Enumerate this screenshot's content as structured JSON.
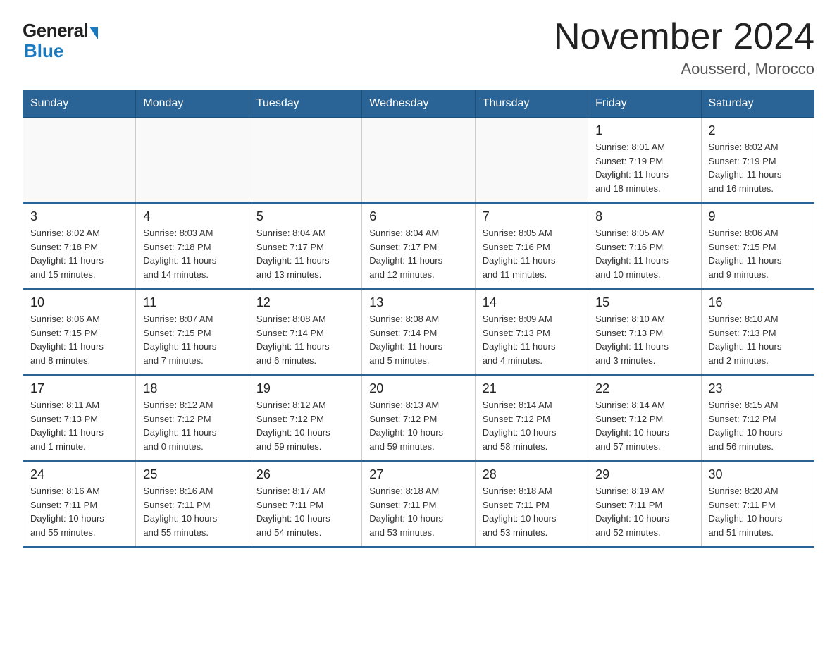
{
  "logo": {
    "general": "General",
    "blue": "Blue"
  },
  "title": "November 2024",
  "location": "Aousserd, Morocco",
  "days_of_week": [
    "Sunday",
    "Monday",
    "Tuesday",
    "Wednesday",
    "Thursday",
    "Friday",
    "Saturday"
  ],
  "weeks": [
    [
      {
        "day": "",
        "info": ""
      },
      {
        "day": "",
        "info": ""
      },
      {
        "day": "",
        "info": ""
      },
      {
        "day": "",
        "info": ""
      },
      {
        "day": "",
        "info": ""
      },
      {
        "day": "1",
        "info": "Sunrise: 8:01 AM\nSunset: 7:19 PM\nDaylight: 11 hours\nand 18 minutes."
      },
      {
        "day": "2",
        "info": "Sunrise: 8:02 AM\nSunset: 7:19 PM\nDaylight: 11 hours\nand 16 minutes."
      }
    ],
    [
      {
        "day": "3",
        "info": "Sunrise: 8:02 AM\nSunset: 7:18 PM\nDaylight: 11 hours\nand 15 minutes."
      },
      {
        "day": "4",
        "info": "Sunrise: 8:03 AM\nSunset: 7:18 PM\nDaylight: 11 hours\nand 14 minutes."
      },
      {
        "day": "5",
        "info": "Sunrise: 8:04 AM\nSunset: 7:17 PM\nDaylight: 11 hours\nand 13 minutes."
      },
      {
        "day": "6",
        "info": "Sunrise: 8:04 AM\nSunset: 7:17 PM\nDaylight: 11 hours\nand 12 minutes."
      },
      {
        "day": "7",
        "info": "Sunrise: 8:05 AM\nSunset: 7:16 PM\nDaylight: 11 hours\nand 11 minutes."
      },
      {
        "day": "8",
        "info": "Sunrise: 8:05 AM\nSunset: 7:16 PM\nDaylight: 11 hours\nand 10 minutes."
      },
      {
        "day": "9",
        "info": "Sunrise: 8:06 AM\nSunset: 7:15 PM\nDaylight: 11 hours\nand 9 minutes."
      }
    ],
    [
      {
        "day": "10",
        "info": "Sunrise: 8:06 AM\nSunset: 7:15 PM\nDaylight: 11 hours\nand 8 minutes."
      },
      {
        "day": "11",
        "info": "Sunrise: 8:07 AM\nSunset: 7:15 PM\nDaylight: 11 hours\nand 7 minutes."
      },
      {
        "day": "12",
        "info": "Sunrise: 8:08 AM\nSunset: 7:14 PM\nDaylight: 11 hours\nand 6 minutes."
      },
      {
        "day": "13",
        "info": "Sunrise: 8:08 AM\nSunset: 7:14 PM\nDaylight: 11 hours\nand 5 minutes."
      },
      {
        "day": "14",
        "info": "Sunrise: 8:09 AM\nSunset: 7:13 PM\nDaylight: 11 hours\nand 4 minutes."
      },
      {
        "day": "15",
        "info": "Sunrise: 8:10 AM\nSunset: 7:13 PM\nDaylight: 11 hours\nand 3 minutes."
      },
      {
        "day": "16",
        "info": "Sunrise: 8:10 AM\nSunset: 7:13 PM\nDaylight: 11 hours\nand 2 minutes."
      }
    ],
    [
      {
        "day": "17",
        "info": "Sunrise: 8:11 AM\nSunset: 7:13 PM\nDaylight: 11 hours\nand 1 minute."
      },
      {
        "day": "18",
        "info": "Sunrise: 8:12 AM\nSunset: 7:12 PM\nDaylight: 11 hours\nand 0 minutes."
      },
      {
        "day": "19",
        "info": "Sunrise: 8:12 AM\nSunset: 7:12 PM\nDaylight: 10 hours\nand 59 minutes."
      },
      {
        "day": "20",
        "info": "Sunrise: 8:13 AM\nSunset: 7:12 PM\nDaylight: 10 hours\nand 59 minutes."
      },
      {
        "day": "21",
        "info": "Sunrise: 8:14 AM\nSunset: 7:12 PM\nDaylight: 10 hours\nand 58 minutes."
      },
      {
        "day": "22",
        "info": "Sunrise: 8:14 AM\nSunset: 7:12 PM\nDaylight: 10 hours\nand 57 minutes."
      },
      {
        "day": "23",
        "info": "Sunrise: 8:15 AM\nSunset: 7:12 PM\nDaylight: 10 hours\nand 56 minutes."
      }
    ],
    [
      {
        "day": "24",
        "info": "Sunrise: 8:16 AM\nSunset: 7:11 PM\nDaylight: 10 hours\nand 55 minutes."
      },
      {
        "day": "25",
        "info": "Sunrise: 8:16 AM\nSunset: 7:11 PM\nDaylight: 10 hours\nand 55 minutes."
      },
      {
        "day": "26",
        "info": "Sunrise: 8:17 AM\nSunset: 7:11 PM\nDaylight: 10 hours\nand 54 minutes."
      },
      {
        "day": "27",
        "info": "Sunrise: 8:18 AM\nSunset: 7:11 PM\nDaylight: 10 hours\nand 53 minutes."
      },
      {
        "day": "28",
        "info": "Sunrise: 8:18 AM\nSunset: 7:11 PM\nDaylight: 10 hours\nand 53 minutes."
      },
      {
        "day": "29",
        "info": "Sunrise: 8:19 AM\nSunset: 7:11 PM\nDaylight: 10 hours\nand 52 minutes."
      },
      {
        "day": "30",
        "info": "Sunrise: 8:20 AM\nSunset: 7:11 PM\nDaylight: 10 hours\nand 51 minutes."
      }
    ]
  ]
}
